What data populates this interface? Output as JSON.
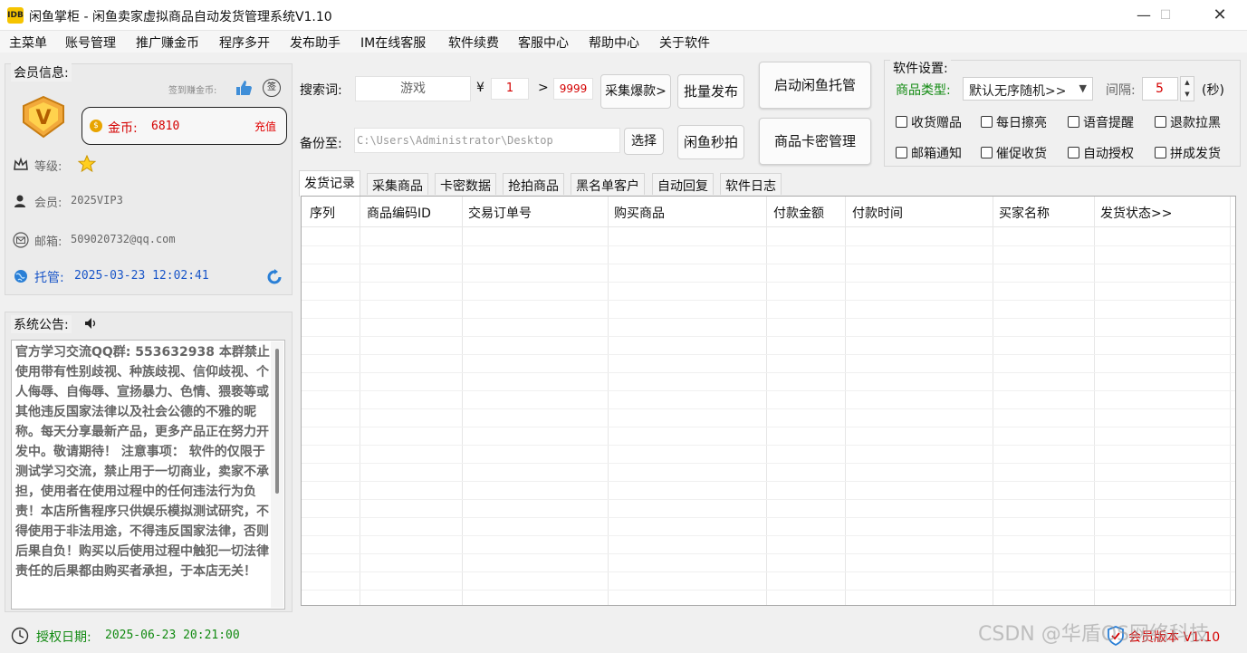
{
  "window": {
    "icon_text": "IDB",
    "title": "闲鱼掌柜 - 闲鱼卖家虚拟商品自动发货管理系统V1.10",
    "min_glyph": "—",
    "max_glyph": "☐",
    "close_glyph": "✕"
  },
  "menu": [
    "主菜单",
    "账号管理",
    "推广赚金币",
    "程序多开",
    "发布助手",
    "IM在线客服",
    "软件续费",
    "客服中心",
    "帮助中心",
    "关于软件"
  ],
  "member": {
    "panel_title": "会员信息:",
    "sign_text": "签到赚金币:",
    "sign_badge": "签",
    "coin_label": "金币:",
    "coin_value": "6810",
    "recharge_label": "充值",
    "level_label": "等级:",
    "member_label": "会员:",
    "member_value": "2025VIP3",
    "email_label": "邮箱:",
    "email_value": "509020732@qq.com",
    "trust_label": "托管:",
    "trust_time": "2025-03-23 12:02:41"
  },
  "notice": {
    "title": "系统公告:",
    "text": "官方学习交流QQ群: 553632938 本群禁止使用带有性别歧视、种族歧视、信仰歧视、个人侮辱、自侮辱、宣扬暴力、色情、猥亵等或其他违反国家法律以及社会公德的不雅的昵称。每天分享最新产品，更多产品正在努力开发中。敬请期待！ 注意事项： 软件的仅限于测试学习交流，禁止用于一切商业，卖家不承担，使用者在使用过程中的任何违法行为负责！本店所售程序只供娱乐模拟测试研究，不得使用于非法用途，不得违反国家法律，否则后果自负！购买以后使用过程中触犯一切法律责任的后果都由购买者承担，于本店无关！"
  },
  "search": {
    "label": "搜索词:",
    "keyword": "游戏",
    "currency": "¥",
    "price_min": "1",
    "arrow": ">",
    "price_max": "9999",
    "collect_button": "采集爆款>",
    "batch_button": "批量发布",
    "backup_label": "备份至:",
    "backup_path": "C:\\Users\\Administrator\\Desktop",
    "choose_button": "选择",
    "flash_button": "闲鱼秒拍",
    "start_button": "启动闲鱼托管",
    "card_button": "商品卡密管理"
  },
  "settings": {
    "title": "软件设置:",
    "type_label": "商品类型:",
    "type_value": "默认无序随机>>",
    "interval_label": "间隔:",
    "interval_value": "5",
    "interval_unit": "(秒)",
    "checkboxes": [
      "收货赠品",
      "每日擦亮",
      "语音提醒",
      "退款拉黑",
      "邮箱通知",
      "催促收货",
      "自动授权",
      "拼成发货"
    ]
  },
  "tabs": [
    "发货记录",
    "采集商品",
    "卡密数据",
    "抢拍商品",
    "黑名单客户",
    "自动回复",
    "软件日志"
  ],
  "grid": {
    "columns": [
      "序列",
      "商品编码ID",
      "交易订单号",
      "购买商品",
      "付款金额",
      "付款时间",
      "买家名称",
      "发货状态>>"
    ]
  },
  "status": {
    "license_label": "授权日期:",
    "license_time": "2025-06-23 20:21:00",
    "version": "会员版本 V1.10"
  },
  "watermark": "CSDN @华盾OS网络科技",
  "colors": {
    "accent_red": "#d40000",
    "accent_blue": "#1a56c8",
    "accent_green": "#118a11",
    "coin_gold": "#e8a400"
  }
}
